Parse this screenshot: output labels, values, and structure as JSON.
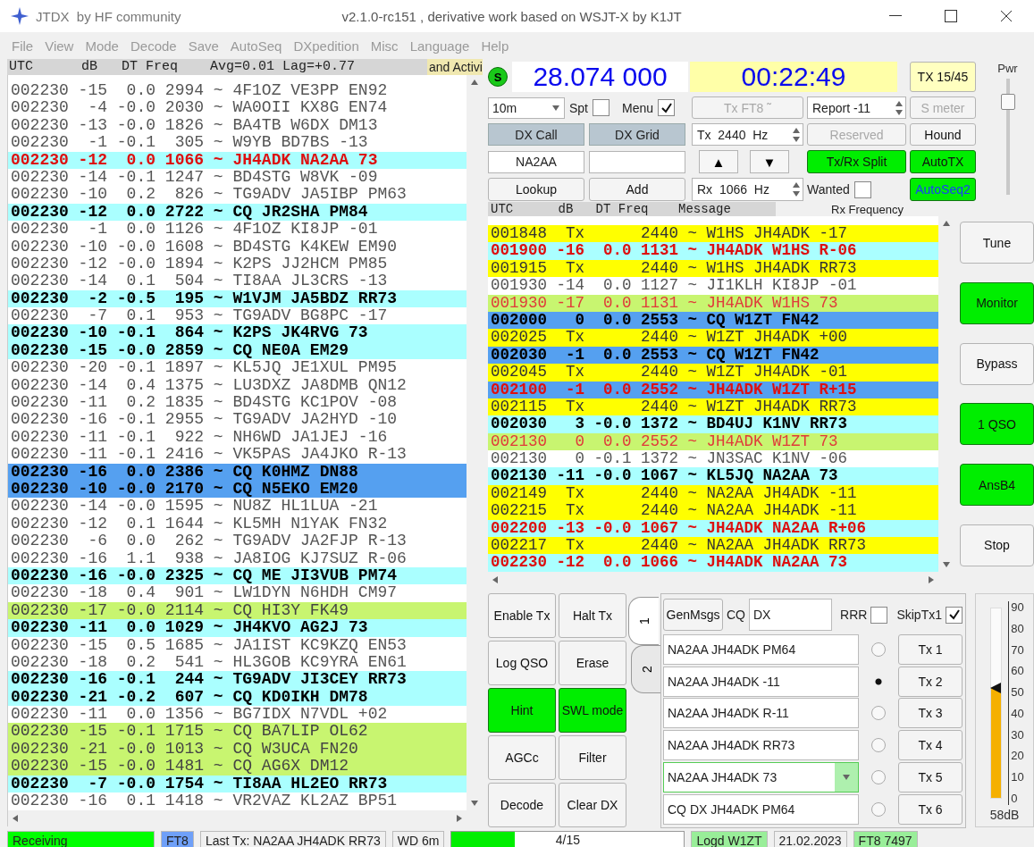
{
  "title_bar": {
    "app": "JTDX  by HF community",
    "subtitle": "v2.1.0-rc151 , derivative work based on WSJT-X by K1JT"
  },
  "menu": [
    "File",
    "View",
    "Mode",
    "Decode",
    "Save",
    "AutoSeq",
    "DXpedition",
    "Misc",
    "Language",
    "Help"
  ],
  "band_activity": {
    "header": "UTC      dB   DT Freq    Avg=0.01 Lag=+0.77",
    "header_2": "and Activi",
    "rows": [
      {
        "kind": "normal",
        "text": "002230 -15  0.0 2994 ~ 4F1OZ VE3PP EN92"
      },
      {
        "kind": "normal",
        "text": "002230  -4 -0.0 2030 ~ WA0OII KX8G EN74"
      },
      {
        "kind": "normal",
        "text": "002230 -13 -0.0 1826 ~ BA4TB W6DX DM13"
      },
      {
        "kind": "normal",
        "text": "002230  -1 -0.1  305 ~ W9YB BD7BS -13"
      },
      {
        "kind": "mine",
        "text": "002230 -12  0.0 1066 ~ JH4ADK NA2AA 73"
      },
      {
        "kind": "normal",
        "text": "002230 -14 -0.1 1247 ~ BD4STG W8VK -09"
      },
      {
        "kind": "normal",
        "text": "002230 -10  0.2  826 ~ TG9ADV JA5IBP PM63"
      },
      {
        "kind": "call",
        "text": "002230 -12  0.0 2722 ~ CQ JR2SHA PM84"
      },
      {
        "kind": "normal",
        "text": "002230  -1  0.0 1126 ~ 4F1OZ KI8JP -01"
      },
      {
        "kind": "normal",
        "text": "002230 -10 -0.0 1608 ~ BD4STG K4KEW EM90"
      },
      {
        "kind": "normal",
        "text": "002230 -12 -0.0 1894 ~ K2PS JJ2HCM PM85"
      },
      {
        "kind": "normal",
        "text": "002230 -14  0.1  504 ~ TI8AA JL3CRS -13"
      },
      {
        "kind": "call",
        "text": "002230  -2 -0.5  195 ~ W1VJM JA5BDZ RR73"
      },
      {
        "kind": "normal",
        "text": "002230  -7  0.1  953 ~ TG9ADV BG8PC -17"
      },
      {
        "kind": "call",
        "text": "002230 -10 -0.1  864 ~ K2PS JK4RVG 73"
      },
      {
        "kind": "call",
        "text": "002230 -15 -0.0 2859 ~ CQ NE0A EM29"
      },
      {
        "kind": "normal",
        "text": "002230 -20 -0.1 1897 ~ KL5JQ JE1XUL PM95"
      },
      {
        "kind": "normal",
        "text": "002230 -14  0.4 1375 ~ LU3DXZ JA8DMB QN12"
      },
      {
        "kind": "normal",
        "text": "002230 -11  0.2 1835 ~ BD4STG KC1POV -08"
      },
      {
        "kind": "normal",
        "text": "002230 -16 -0.1 2955 ~ TG9ADV JA2HYD -10"
      },
      {
        "kind": "normal",
        "text": "002230 -11 -0.1  922 ~ NH6WD JA1JEJ -16"
      },
      {
        "kind": "normal",
        "text": "002230 -11 -0.1 2416 ~ VK5PAS JA4JKO R-13"
      },
      {
        "kind": "new",
        "text": "002230 -16  0.0 2386 ~ CQ K0HMZ DN88"
      },
      {
        "kind": "new",
        "text": "002230 -10 -0.0 2170 ~ CQ N5EKO EM20"
      },
      {
        "kind": "normal",
        "text": "002230 -14 -0.0 1595 ~ NU8Z HL1LUA -21"
      },
      {
        "kind": "normal",
        "text": "002230 -12  0.1 1644 ~ KL5MH N1YAK FN32"
      },
      {
        "kind": "normal",
        "text": "002230  -6  0.0  262 ~ TG9ADV JA2FJP R-13"
      },
      {
        "kind": "normal",
        "text": "002230 -16  1.1  938 ~ JA8IOG KJ7SUZ R-06"
      },
      {
        "kind": "call",
        "text": "002230 -16 -0.0 2325 ~ CQ ME JI3VUB PM74"
      },
      {
        "kind": "normal",
        "text": "002230 -18  0.4  901 ~ LW1DYN N6HDH CM97"
      },
      {
        "kind": "lime",
        "text": "002230 -17 -0.0 2114 ~ CQ HI3Y FK49"
      },
      {
        "kind": "call",
        "text": "002230 -11  0.0 1029 ~ JH4KVO AG2J 73"
      },
      {
        "kind": "normal",
        "text": "002230 -15  0.5 1685 ~ JA1IST KC9KZQ EN53"
      },
      {
        "kind": "normal",
        "text": "002230 -18  0.2  541 ~ HL3GOB KC9YRA EN61"
      },
      {
        "kind": "call",
        "text": "002230 -16 -0.1  244 ~ TG9ADV JI3CEY RR73"
      },
      {
        "kind": "call",
        "text": "002230 -21 -0.2  607 ~ CQ KD0IKH DM78"
      },
      {
        "kind": "normal",
        "text": "002230 -11  0.0 1356 ~ BG7IDX N7VDL +02"
      },
      {
        "kind": "lime",
        "text": "002230 -15 -0.1 1715 ~ CQ BA7LIP OL62"
      },
      {
        "kind": "lime",
        "text": "002230 -21 -0.0 1013 ~ CQ W3UCA FN20"
      },
      {
        "kind": "lime",
        "text": "002230 -15 -0.0 1481 ~ CQ AG6X DM12"
      },
      {
        "kind": "call",
        "text": "002230  -7 -0.0 1754 ~ TI8AA HL2EO RR73"
      },
      {
        "kind": "normal",
        "text": "002230 -16  0.1 1418 ~ VR2VAZ KL2AZ BP51"
      }
    ]
  },
  "s_indicator": "S",
  "frequency": "28.074 000",
  "clock": "00:22:49",
  "tx_period": "TX 15/45",
  "power": {
    "label": "Pwr",
    "level": 0.85
  },
  "band": "10m",
  "spt": {
    "label": "Spt",
    "checked": false
  },
  "menu_toggle": {
    "label": "Menu",
    "checked": true
  },
  "tx_mode": {
    "label": "Tx FT8 ˜",
    "disabled": true
  },
  "report": "Report -11",
  "s_meter": {
    "label": "S meter",
    "disabled": true
  },
  "dx_call": {
    "label": "DX Call",
    "value": "NA2AA"
  },
  "dx_grid": {
    "label": "DX Grid"
  },
  "tx_freq": "Tx  2440  Hz",
  "rx_freq": "Rx  1066  Hz",
  "up": "▲",
  "down": "▼",
  "reserved": {
    "label": "Reserved",
    "disabled": true
  },
  "hound": {
    "label": "Hound",
    "on": false
  },
  "split": {
    "label": "Tx/Rx Split",
    "on": true
  },
  "autotx": {
    "label": "AutoTX",
    "on": true
  },
  "autoseq": {
    "label": "AutoSeq2",
    "on": true
  },
  "lookup": "Lookup",
  "add": "Add",
  "wanted": {
    "label": "Wanted",
    "checked": false
  },
  "rx_frequency": {
    "header": "UTC      dB   DT Freq    Message",
    "label": "Rx Frequency",
    "rows": [
      {
        "kind": "tx",
        "text": "001848  Tx      2440 ~ W1HS JH4ADK -17"
      },
      {
        "kind": "mine",
        "text": "001900 -16  0.0 1131 ~ JH4ADK W1HS R-06"
      },
      {
        "kind": "tx",
        "text": "001915  Tx      2440 ~ W1HS JH4ADK RR73"
      },
      {
        "kind": "normal",
        "text": "001930 -14  0.0 1127 ~ JI1KLH KI8JP -01"
      },
      {
        "kind": "limemine",
        "text": "001930 -17  0.0 1131 ~ JH4ADK W1HS 73"
      },
      {
        "kind": "new",
        "text": "002000   0  0.0 2553 ~ CQ W1ZT FN42"
      },
      {
        "kind": "tx",
        "text": "002025  Tx      2440 ~ W1ZT JH4ADK +00"
      },
      {
        "kind": "new",
        "text": "002030  -1  0.0 2553 ~ CQ W1ZT FN42"
      },
      {
        "kind": "tx",
        "text": "002045  Tx      2440 ~ W1ZT JH4ADK -01"
      },
      {
        "kind": "newmine",
        "text": "002100  -1  0.0 2552 ~ JH4ADK W1ZT R+15"
      },
      {
        "kind": "tx",
        "text": "002115  Tx      2440 ~ W1ZT JH4ADK RR73"
      },
      {
        "kind": "call",
        "text": "002030   3 -0.0 1372 ~ BD4UJ K1NV RR73"
      },
      {
        "kind": "limemine",
        "text": "002130   0  0.0 2552 ~ JH4ADK W1ZT 73"
      },
      {
        "kind": "normal",
        "text": "002130   0 -0.1 1372 ~ JN3SAC K1NV -06"
      },
      {
        "kind": "call",
        "text": "002130 -11 -0.0 1067 ~ KL5JQ NA2AA 73"
      },
      {
        "kind": "tx",
        "text": "002149  Tx      2440 ~ NA2AA JH4ADK -11"
      },
      {
        "kind": "tx",
        "text": "002215  Tx      2440 ~ NA2AA JH4ADK -11"
      },
      {
        "kind": "mine",
        "text": "002200 -13 -0.0 1067 ~ JH4ADK NA2AA R+06"
      },
      {
        "kind": "tx",
        "text": "002217  Tx      2440 ~ NA2AA JH4ADK RR73"
      },
      {
        "kind": "mine",
        "text": "002230 -12  0.0 1066 ~ JH4ADK NA2AA 73"
      }
    ]
  },
  "side_buttons": [
    {
      "label": "Tune",
      "on": false
    },
    {
      "label": "Monitor",
      "on": true
    },
    {
      "label": "Bypass",
      "on": false
    },
    {
      "label": "1 QSO",
      "on": true
    },
    {
      "label": "AnsB4",
      "on": true
    },
    {
      "label": "Stop",
      "on": false
    }
  ],
  "action_buttons": [
    {
      "label": "Enable Tx",
      "on": false
    },
    {
      "label": "Halt Tx",
      "on": false
    },
    {
      "label": "Log QSO",
      "on": false
    },
    {
      "label": "Erase",
      "on": false
    },
    {
      "label": "Hint",
      "on": true
    },
    {
      "label": "SWL mode",
      "on": true
    },
    {
      "label": "AGCc",
      "on": false
    },
    {
      "label": "Filter",
      "on": false
    },
    {
      "label": "Decode",
      "on": false
    },
    {
      "label": "Clear DX",
      "on": false
    }
  ],
  "tabs": [
    {
      "label": "1",
      "selected": true
    },
    {
      "label": "2",
      "selected": false
    }
  ],
  "messages": {
    "gen": "GenMsgs",
    "cq_label": "CQ",
    "cq_value": "DX",
    "rrr": {
      "label": "RRR",
      "checked": false
    },
    "skip": {
      "label": "SkipTx1",
      "checked": true
    },
    "rows": [
      {
        "kind": "field",
        "text": "NA2AA JH4ADK PM64",
        "selected": false,
        "button": "Tx 1"
      },
      {
        "kind": "field",
        "text": "NA2AA JH4ADK -11",
        "selected": true,
        "button": "Tx 2"
      },
      {
        "kind": "field",
        "text": "NA2AA JH4ADK R-11",
        "selected": false,
        "button": "Tx 3"
      },
      {
        "kind": "field",
        "text": "NA2AA JH4ADK RR73",
        "selected": false,
        "button": "Tx 4"
      },
      {
        "kind": "combo",
        "text": "NA2AA JH4ADK 73",
        "selected": false,
        "button": "Tx 5"
      },
      {
        "kind": "field",
        "text": "CQ DX JH4ADK PM64",
        "selected": false,
        "button": "Tx 6"
      }
    ]
  },
  "meter": {
    "ticks": [
      "90",
      "80",
      "70",
      "60",
      "50",
      "40",
      "30",
      "20",
      "10",
      "0"
    ],
    "level": 0.58,
    "reading": "58dB"
  },
  "status": [
    {
      "kind": "label",
      "text": "Receiving",
      "color": "#00ff00"
    },
    {
      "kind": "label",
      "text": "FT8",
      "color": "#6fa0f8"
    },
    {
      "kind": "label",
      "text": "Last Tx: NA2AA JH4ADK RR73",
      "color": "#f0f0f0"
    },
    {
      "kind": "label",
      "text": "WD 6m",
      "color": "#f0f0f0"
    },
    {
      "kind": "progress",
      "text": "4/15",
      "level": 0.27
    },
    {
      "kind": "label",
      "text": "Logd W1ZT",
      "color": "#99ee99"
    },
    {
      "kind": "label",
      "text": "21.02.2023",
      "color": "#f0f0f0"
    },
    {
      "kind": "label",
      "text": "FT8  7497",
      "color": "#99ee99"
    }
  ]
}
